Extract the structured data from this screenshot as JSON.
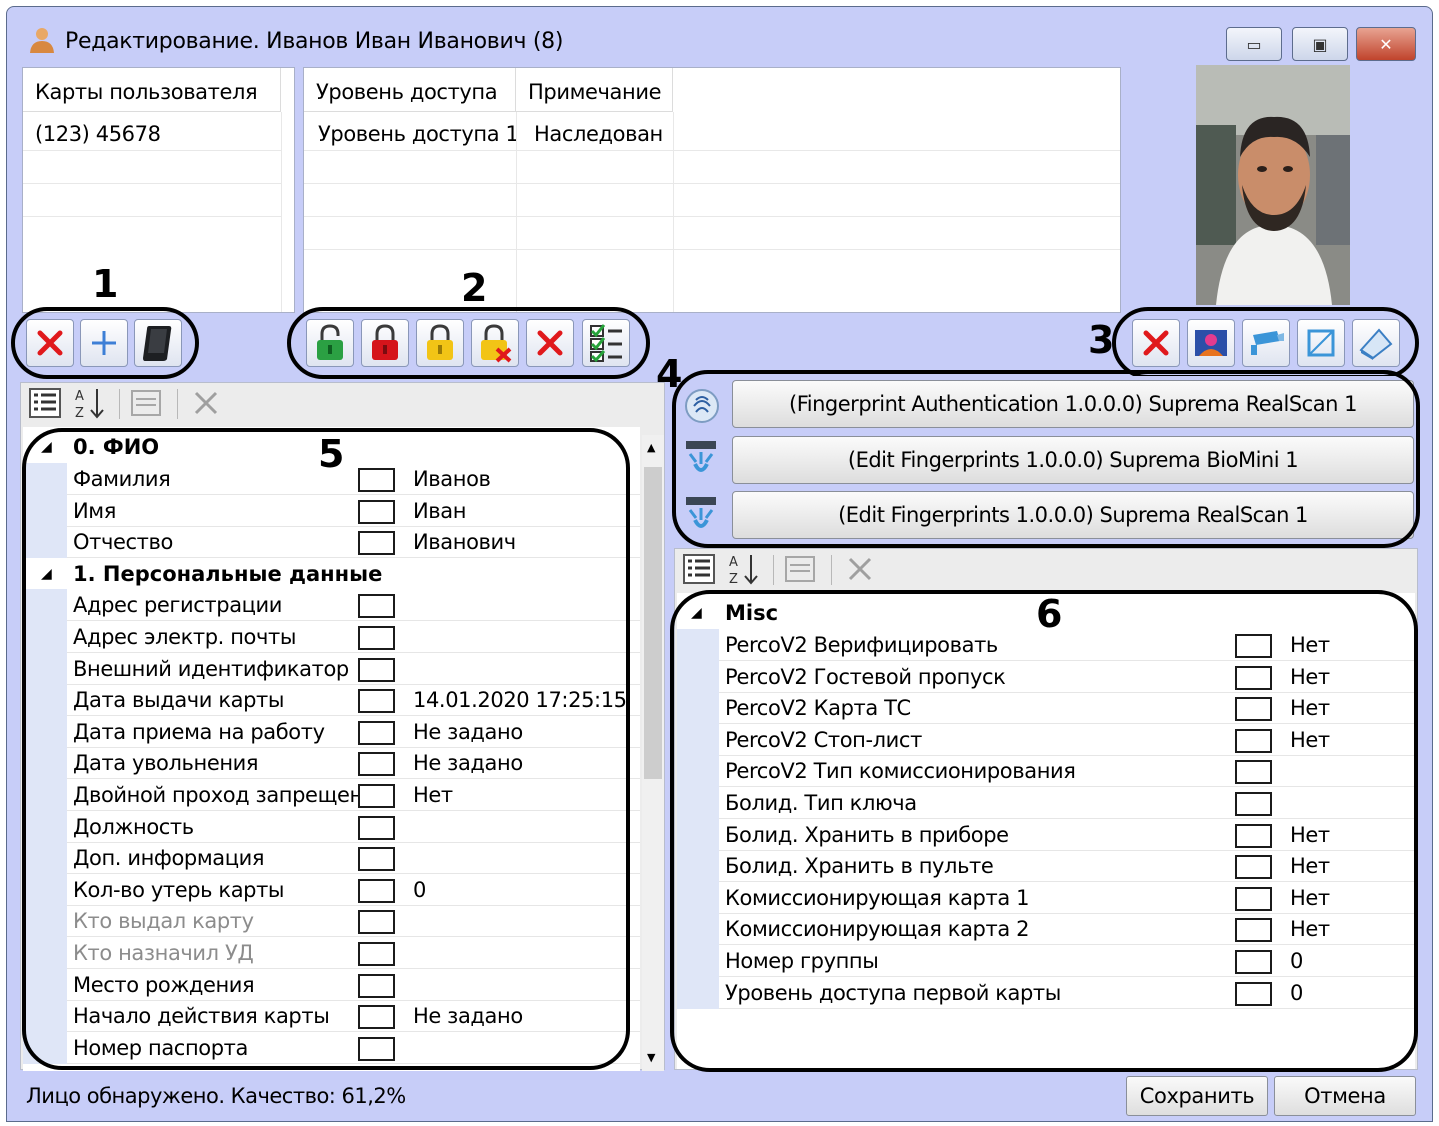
{
  "window": {
    "title": "Редактирование. Иванов Иван Иванович (8)",
    "user_icon": "user-icon",
    "minimize": "▭",
    "maximize": "▣",
    "close": "✕"
  },
  "cards_table": {
    "header": "Карты пользователя",
    "rows": [
      "(123) 45678"
    ]
  },
  "access_table": {
    "headers": [
      "Уровень доступа",
      "Примечание"
    ],
    "rows": [
      [
        "Уровень доступа 1",
        "Наследован"
      ]
    ]
  },
  "callouts": {
    "n1": "1",
    "n2": "2",
    "n3": "3",
    "n4": "4",
    "n5": "5",
    "n6": "6"
  },
  "toolbar1": {
    "icons": [
      "delete-card-icon",
      "add-card-icon",
      "card-reader-icon"
    ]
  },
  "toolbar2": {
    "icons": [
      "lock-green-icon",
      "lock-red-icon",
      "lock-yellow-icon",
      "lock-remove-icon",
      "delete-icon",
      "checklist-icon"
    ]
  },
  "toolbar3": {
    "icons": [
      "delete-photo-icon",
      "photo-icon",
      "camera-icon",
      "crop-icon",
      "scanner-icon"
    ]
  },
  "fingerprint_buttons": [
    "(Fingerprint Authentication 1.0.0.0) Suprema RealScan 1",
    "(Edit Fingerprints 1.0.0.0) Suprema BioMini 1",
    "(Edit Fingerprints 1.0.0.0) Suprema RealScan 1"
  ],
  "left_grid": {
    "categories": [
      {
        "name": "0. ФИО",
        "rows": [
          {
            "label": "Фамилия",
            "value": "Иванов"
          },
          {
            "label": "Имя",
            "value": "Иван"
          },
          {
            "label": "Отчество",
            "value": "Иванович"
          }
        ]
      },
      {
        "name": "1. Персональные данные",
        "rows": [
          {
            "label": "Адрес регистрации",
            "value": ""
          },
          {
            "label": "Адрес электр. почты",
            "value": ""
          },
          {
            "label": "Внешний идентификатор",
            "value": ""
          },
          {
            "label": "Дата выдачи карты",
            "value": "14.01.2020 17:25:15"
          },
          {
            "label": "Дата приема на работу",
            "value": "Не задано"
          },
          {
            "label": "Дата увольнения",
            "value": "Не задано"
          },
          {
            "label": "Двойной проход запрещен",
            "value": "Нет"
          },
          {
            "label": "Должность",
            "value": ""
          },
          {
            "label": "Доп. информация",
            "value": ""
          },
          {
            "label": "Кол-во утерь карты",
            "value": "0"
          },
          {
            "label": "Кто выдал карту",
            "value": ""
          },
          {
            "label": "Кто назначил УД",
            "value": ""
          },
          {
            "label": "Место рождения",
            "value": ""
          },
          {
            "label": "Начало действия карты",
            "value": "Не задано"
          },
          {
            "label": "Номер паспорта",
            "value": ""
          }
        ]
      }
    ]
  },
  "right_grid": {
    "category": "Misc",
    "rows": [
      {
        "label": "PercoV2 Верифицировать",
        "value": "Нет"
      },
      {
        "label": "PercoV2 Гостевой пропуск",
        "value": "Нет"
      },
      {
        "label": "PercoV2 Карта ТС",
        "value": "Нет"
      },
      {
        "label": "PercoV2 Стоп-лист",
        "value": "Нет"
      },
      {
        "label": "PercoV2 Тип комиссионирования",
        "value": ""
      },
      {
        "label": "Болид. Тип ключа",
        "value": ""
      },
      {
        "label": "Болид. Хранить в приборе",
        "value": "Нет"
      },
      {
        "label": "Болид. Хранить в пульте",
        "value": "Нет"
      },
      {
        "label": "Комиссионирующая карта 1",
        "value": "Нет"
      },
      {
        "label": "Комиссионирующая карта 2",
        "value": "Нет"
      },
      {
        "label": "Номер группы",
        "value": "0"
      },
      {
        "label": "Уровень доступа первой карты",
        "value": "0"
      }
    ]
  },
  "status": "Лицо обнаружено. Качество: 61,2%",
  "buttons": {
    "save": "Сохранить",
    "cancel": "Отмена"
  }
}
